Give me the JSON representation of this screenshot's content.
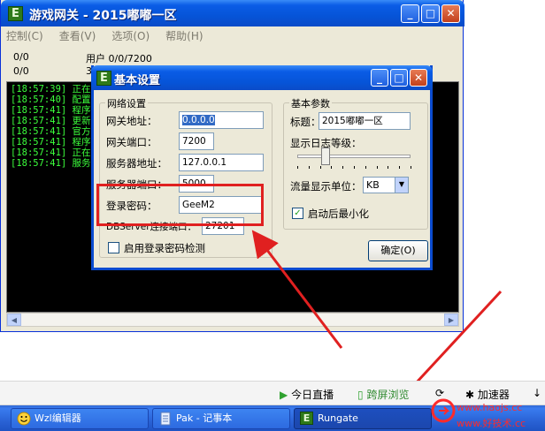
{
  "main_window": {
    "title": "游戏网关  - 2015嘟嘟一区",
    "menu": [
      "控制(C)",
      "查看(V)",
      "选项(O)",
      "帮助(H)"
    ],
    "status": {
      "left_top": "0/0",
      "left_bottom": "0/0",
      "users_label": "用户 0/0/7200",
      "users_bottom_partial": "3"
    },
    "log_lines": [
      "[18:57:39] 正在",
      "[18:57:40] 配置",
      "[18:57:41] 程序",
      "[18:57:41] 更新",
      "[18:57:41] 官方",
      "[18:57:41] 程序",
      "[18:57:41] 正在",
      "[18:57:41] 服务"
    ]
  },
  "dialog": {
    "title": "基本设置",
    "network_group": {
      "caption": "网络设置",
      "gateway_addr_label": "网关地址：",
      "gateway_addr_value": "0.0.0.0",
      "gateway_port_label": "网关端口：",
      "gateway_port_value": "7200",
      "server_addr_label": "服务器地址：",
      "server_addr_value": "127.0.0.1",
      "server_port_label": "服务器端口：",
      "server_port_value": "5000",
      "login_pwd_label": "登录密码：",
      "login_pwd_value": "GeeM2",
      "dbserver_port_label": "DBServer连接端口：",
      "dbserver_port_value": "27201",
      "enable_check_label": "启用登录密码检测",
      "enable_check_checked": false
    },
    "basic_group": {
      "caption": "基本参数",
      "title_label": "标题：",
      "title_value": "2015嘟嘟一区",
      "log_level_label": "显示日志等级：",
      "log_level": 0.25,
      "flow_unit_label": "流量显示单位：",
      "flow_unit_value": "KB",
      "minimize_label": "启动后最小化",
      "minimize_checked": true
    },
    "ok_button": "确定(O)"
  },
  "toolbar2": {
    "live": "今日直播",
    "browse": "跨屏浏览",
    "accelerator": "加速器"
  },
  "taskbar": {
    "items": [
      "Wzl编辑器",
      "Pak - 记事本",
      "Rungate"
    ]
  },
  "watermark": {
    "line1": "www.haojs.cc",
    "line2": "www.好技术.cc"
  },
  "colors": {
    "annotation_red": "#e02020",
    "log_green": "#3cff3c",
    "xp_blue": "#0a5ce6"
  }
}
